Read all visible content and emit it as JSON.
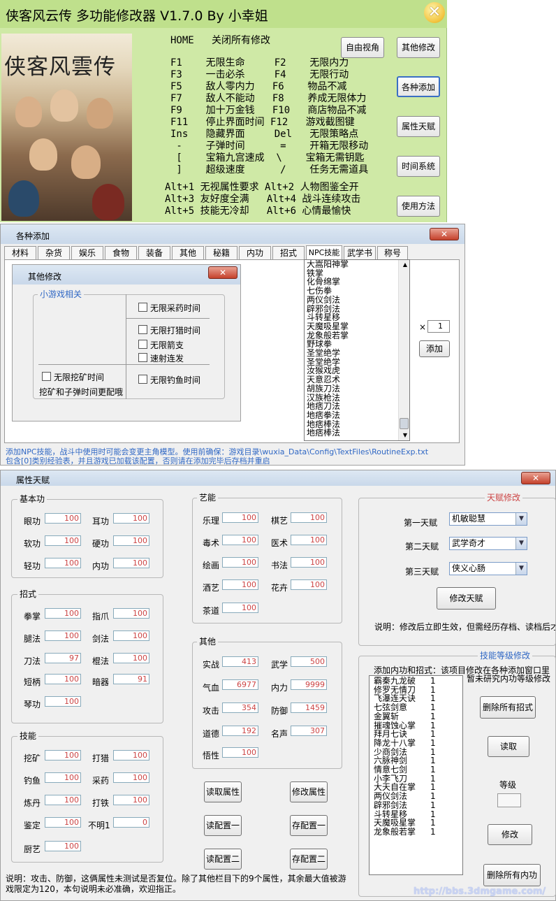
{
  "main": {
    "title": "侠客风云传 多功能修改器 V1.7.0 By 小幸姐",
    "poster_title": "侠客风雲传",
    "hotkeys": [
      "HOME   关闭所有修改",
      "F1    无限生命     F2    无限内力",
      "F3    一击必杀     F4    无限行动",
      "F5    敌人零内力   F6    物品不减",
      "F7    敌人不能动   F8    养成无限体力",
      "F9    加十万金钱   F10   商店物品不减",
      "F11   停止界面时间 F12   游戏截图键",
      "Ins   隐藏界面     Del   无限策略点",
      " -    子弹时间      =    开箱无限移动",
      " [    宝箱九宫速成  \\    宝箱无需钥匙",
      " ]    超级速度      /    任务无需道具",
      "Alt+1 无视属性要求 Alt+2 人物图鉴全开",
      "Alt+3 友好度全满   Alt+4 战斗连续攻击",
      "Alt+5 技能无冷却   Alt+6 心情最愉快"
    ],
    "buttons": [
      "自由视角",
      "其他修改",
      "各种添加",
      "属性天赋",
      "时间系统",
      "使用方法"
    ]
  },
  "add_window": {
    "title": "各种添加",
    "tabs": [
      "材料",
      "杂货",
      "娱乐",
      "食物",
      "装备",
      "其他",
      "秘籍",
      "内功",
      "招式",
      "NPC技能",
      "武学书",
      "称号"
    ],
    "list": [
      "大嵩阳神掌",
      "铁掌",
      "化骨绵掌",
      "七伤拳",
      "两仪剑法",
      "辟邪剑法",
      "斗转星移",
      "天魔吸星掌",
      "龙象般若掌",
      "野球拳",
      "圣堂绝学",
      "圣堂绝学",
      "汝猴戏虎",
      "天意忍术",
      "胡族刀法",
      "汉族枪法",
      "地痞刀法",
      "地痞拳法",
      "地痞棒法",
      "地痞棒法"
    ],
    "qty_prefix": "×",
    "qty": "1",
    "add_btn": "添加",
    "note1": "添加NPC技能，战斗中使用时可能会变更主角模型。使用前确保：游戏目录\\wuxia_Data\\Config\\TextFiles\\RoutineExp.txt",
    "note2": "包含[0]类别经验表，并且游戏已加载该配置，否则请在添加完毕后存档并重启"
  },
  "other_window": {
    "title": "其他修改",
    "group": "小游戏相关",
    "checks": [
      "无限采药时间",
      "无限打猎时间",
      "无限箭支",
      "速射连发",
      "无限挖矿时间",
      "无限钓鱼时间"
    ],
    "note": "挖矿和子弹时间更配哦"
  },
  "attr_window": {
    "title": "属性天赋",
    "basic": {
      "label": "基本功",
      "items": [
        [
          "眼功",
          "100"
        ],
        [
          "耳功",
          "100"
        ],
        [
          "软功",
          "100"
        ],
        [
          "硬功",
          "100"
        ],
        [
          "轻功",
          "100"
        ],
        [
          "内功",
          "100"
        ]
      ]
    },
    "moves": {
      "label": "招式",
      "items": [
        [
          "拳掌",
          "100"
        ],
        [
          "指爪",
          "100"
        ],
        [
          "腿法",
          "100"
        ],
        [
          "剑法",
          "100"
        ],
        [
          "刀法",
          "97"
        ],
        [
          "棍法",
          "100"
        ],
        [
          "短柄",
          "100"
        ],
        [
          "暗器",
          "91"
        ],
        [
          "琴功",
          "100"
        ]
      ]
    },
    "skills": {
      "label": "技能",
      "items": [
        [
          "挖矿",
          "100"
        ],
        [
          "打猎",
          "100"
        ],
        [
          "钓鱼",
          "100"
        ],
        [
          "采药",
          "100"
        ],
        [
          "炼丹",
          "100"
        ],
        [
          "打铁",
          "100"
        ],
        [
          "鉴定",
          "100"
        ],
        [
          "不明1",
          "0"
        ],
        [
          "厨艺",
          "100"
        ]
      ]
    },
    "arts": {
      "label": "艺能",
      "items": [
        [
          "乐理",
          "100"
        ],
        [
          "棋艺",
          "100"
        ],
        [
          "毒术",
          "100"
        ],
        [
          "医术",
          "100"
        ],
        [
          "绘画",
          "100"
        ],
        [
          "书法",
          "100"
        ],
        [
          "酒艺",
          "100"
        ],
        [
          "花卉",
          "100"
        ],
        [
          "茶道",
          "100"
        ]
      ]
    },
    "others": {
      "label": "其他",
      "items": [
        [
          "实战",
          "413"
        ],
        [
          "武学",
          "500"
        ],
        [
          "气血",
          "6977"
        ],
        [
          "内力",
          "9999"
        ],
        [
          "攻击",
          "354"
        ],
        [
          "防御",
          "1459"
        ],
        [
          "道德",
          "192"
        ],
        [
          "名声",
          "307"
        ],
        [
          "悟性",
          "100"
        ]
      ]
    },
    "buttons": [
      "读取属性",
      "修改属性",
      "读配置一",
      "存配置一",
      "读配置二",
      "存配置二"
    ],
    "talent": {
      "label": "天赋修改",
      "rows": [
        [
          "第一天赋",
          "机敏聪慧"
        ],
        [
          "第二天赋",
          "武学奇才"
        ],
        [
          "第三天赋",
          "侠义心肠"
        ]
      ],
      "button": "修改天赋",
      "note": "说明：修改后立即生效，但需经历存档、读档后才"
    },
    "skill_level": {
      "label": "技能等级修改",
      "note1": "添加内功和招式：该项目修改在各种添加窗口里",
      "note2": "暂未研究内功等级修改",
      "list": [
        [
          "霸秦九龙破",
          "1"
        ],
        [
          "修罗无情刀",
          "1"
        ],
        [
          "飞瀑连天诀",
          "1"
        ],
        [
          "七弦剑意",
          "1"
        ],
        [
          "金翼斩",
          "1"
        ],
        [
          "摧魂蚀心掌",
          "1"
        ],
        [
          "拜月七诀",
          "1"
        ],
        [
          "降龙十八掌",
          "1"
        ],
        [
          "少商剑法",
          "1"
        ],
        [
          "六脉神剑",
          "1"
        ],
        [
          "情意七剑",
          "1"
        ],
        [
          "小李飞刀",
          "1"
        ],
        [
          "大天自在掌",
          "1"
        ],
        [
          "两仪剑法",
          "1"
        ],
        [
          "辟邪剑法",
          "1"
        ],
        [
          "斗转星移",
          "1"
        ],
        [
          "天魔吸星掌",
          "1"
        ],
        [
          "龙象般若掌",
          "1"
        ]
      ],
      "btn_del_moves": "删除所有招式",
      "btn_read": "读取",
      "level_label": "等级",
      "level_value": "",
      "btn_modify": "修改",
      "btn_del_inner": "删除所有内功"
    },
    "note": "说明：攻击、防御，这俩属性未测试是否复位。除了其他栏目下的9个属性，其余最大值被游戏限定为120，本句说明未必准确，欢迎指正。",
    "url": "http://bbs.3dmgame.com/"
  }
}
